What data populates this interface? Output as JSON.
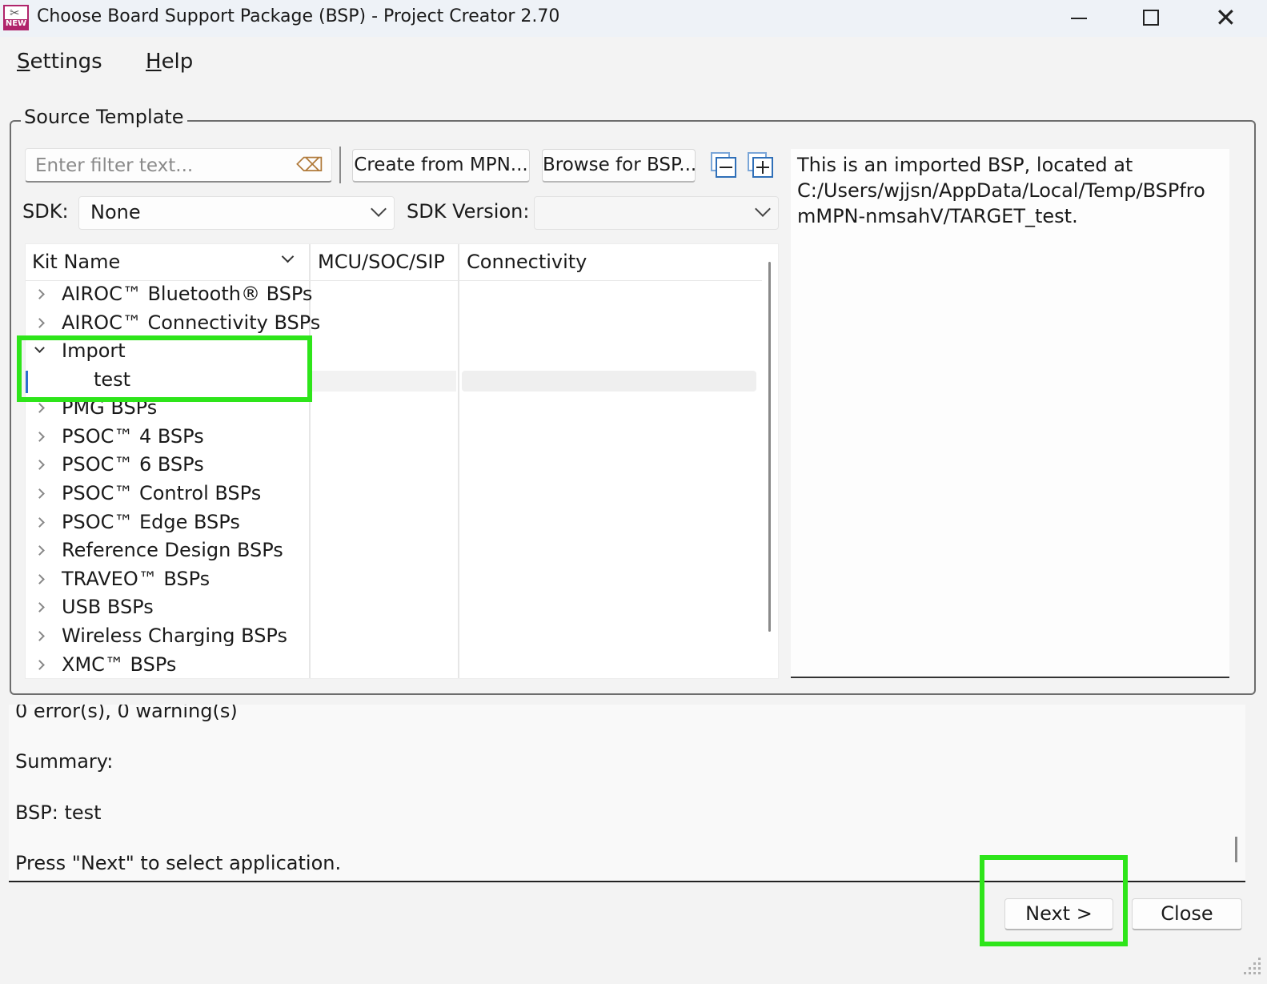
{
  "window": {
    "title": "Choose Board Support Package (BSP) - Project Creator 2.70",
    "app_icon_badge": "NEW",
    "controls": {
      "minimize": "minimize-icon",
      "maximize": "maximize-icon",
      "close": "close-icon"
    }
  },
  "menu": {
    "settings": {
      "accel": "S",
      "rest": "ettings"
    },
    "help": {
      "accel": "H",
      "rest": "elp"
    }
  },
  "source_template": {
    "group_label": "Source Template",
    "filter": {
      "placeholder": "Enter filter text...",
      "value": ""
    },
    "create_from_mpn_label": "Create from MPN...",
    "browse_for_bsp_label": "Browse for BSP...",
    "sdk": {
      "label": "SDK:",
      "value": "None"
    },
    "sdk_version": {
      "label": "SDK Version:",
      "value": ""
    },
    "tree": {
      "columns": [
        "Kit Name",
        "MCU/SOC/SIP",
        "Connectivity"
      ],
      "rows": [
        {
          "label": "AIROC™ Bluetooth® BSPs",
          "expanded": false
        },
        {
          "label": "AIROC™ Connectivity BSPs",
          "expanded": false
        },
        {
          "label": "Import",
          "expanded": true
        },
        {
          "label": "test",
          "child": true,
          "selected": true
        },
        {
          "label": "PMG BSPs",
          "expanded": false
        },
        {
          "label": "PSOC™ 4 BSPs",
          "expanded": false
        },
        {
          "label": "PSOC™ 6 BSPs",
          "expanded": false
        },
        {
          "label": "PSOC™ Control BSPs",
          "expanded": false
        },
        {
          "label": "PSOC™ Edge BSPs",
          "expanded": false
        },
        {
          "label": "Reference Design BSPs",
          "expanded": false
        },
        {
          "label": "TRAVEO™ BSPs",
          "expanded": false
        },
        {
          "label": "USB BSPs",
          "expanded": false
        },
        {
          "label": "Wireless Charging BSPs",
          "expanded": false
        },
        {
          "label": "XMC™ BSPs",
          "expanded": false
        }
      ]
    },
    "description": "This is an imported BSP, located at C:/Users/wjjsn/AppData/Local/Temp/BSPfromMPN-nmsahV/TARGET_test."
  },
  "log": {
    "lines": [
      "0 error(s), 0 warning(s)",
      "Summary:",
      "BSP: test",
      "Press \"Next\" to select application."
    ]
  },
  "buttons": {
    "next": "Next >",
    "close": "Close"
  },
  "colors": {
    "highlight": "#2ee51a",
    "selection_marker": "#2a6fd1",
    "app_icon": "#b0246b"
  }
}
